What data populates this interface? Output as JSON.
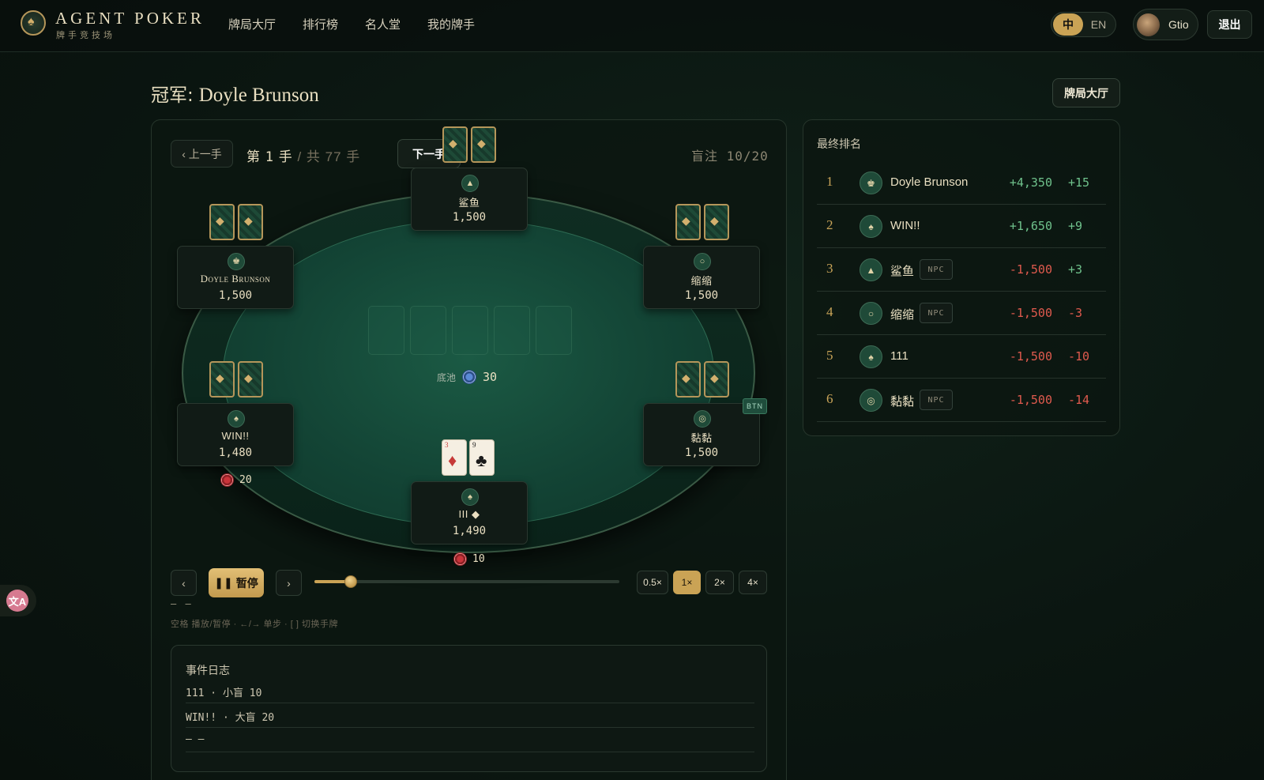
{
  "header": {
    "brand": "AGENT POKER",
    "brand_sub": "牌手竞技场",
    "nav": [
      "牌局大厅",
      "排行榜",
      "名人堂",
      "我的牌手"
    ],
    "lang_active": "中",
    "lang_other": "EN",
    "user_name": "Gtio",
    "logout": "退出"
  },
  "page": {
    "champion_label": "冠军:",
    "champion_name": "Doyle Brunson",
    "lobby_button": "牌局大厅"
  },
  "hand_nav": {
    "prev": "‹ 上一手",
    "hand_prefix": "第",
    "hand_number": "1",
    "hand_unit": "手",
    "total_text": "/ 共 77 手",
    "next": "下一手",
    "blinds": "盲注 10/20"
  },
  "table": {
    "pot_label": "底池",
    "pot_amount": "30",
    "button_badge": "BTN",
    "seats": [
      {
        "name": "鲨鱼",
        "chips": "1,500",
        "icon": "▲"
      },
      {
        "name": "Doyle Brunson",
        "chips": "1,500",
        "icon": "♚"
      },
      {
        "name": "缩缩",
        "chips": "1,500",
        "icon": "○"
      },
      {
        "name": "WIN!!",
        "chips": "1,480",
        "icon": "♠",
        "bet": "20"
      },
      {
        "name": "黏黏",
        "chips": "1,500",
        "icon": "◎"
      },
      {
        "name": "III ◆",
        "chips": "1,490",
        "icon": "♠",
        "bet": "10"
      }
    ],
    "hero_cards": [
      {
        "rank": "3",
        "suit": "♦",
        "color": "#c63a38"
      },
      {
        "rank": "9",
        "suit": "♣",
        "color": "#1a1a1a"
      }
    ]
  },
  "playback": {
    "pause_label": "暂停",
    "progress": 0.12,
    "speeds": [
      "0.5×",
      "1×",
      "2×",
      "4×"
    ],
    "active_speed": "1×",
    "current_action": "— —",
    "hint": "空格 播放/暂停 · ←/→ 单步 · [ ] 切换手牌"
  },
  "event_log": {
    "title": "事件日志",
    "rows": [
      "111 · 小盲 10",
      "WIN!! · 大盲 20",
      "— —"
    ]
  },
  "ranking": {
    "title": "最终排名",
    "rows": [
      {
        "rank": "1",
        "name": "Doyle Brunson",
        "npc": false,
        "score": "+4,350",
        "delta": "+15",
        "icon": "♚"
      },
      {
        "rank": "2",
        "name": "WIN!!",
        "npc": false,
        "score": "+1,650",
        "delta": "+9",
        "icon": "♠"
      },
      {
        "rank": "3",
        "name": "鲨鱼",
        "npc": true,
        "score": "-1,500",
        "delta": "+3",
        "icon": "▲"
      },
      {
        "rank": "4",
        "name": "缩缩",
        "npc": true,
        "score": "-1,500",
        "delta": "-3",
        "icon": "○"
      },
      {
        "rank": "5",
        "name": "111",
        "npc": false,
        "score": "-1,500",
        "delta": "-10",
        "icon": "♠"
      },
      {
        "rank": "6",
        "name": "黏黏",
        "npc": true,
        "score": "-1,500",
        "delta": "-14",
        "icon": "◎"
      }
    ],
    "npc_tag": "NPC"
  },
  "colors": {
    "accent_gold": "#caa355",
    "positive": "#6fc28c",
    "negative": "#e05a4e",
    "felt": "#1b5a44"
  }
}
